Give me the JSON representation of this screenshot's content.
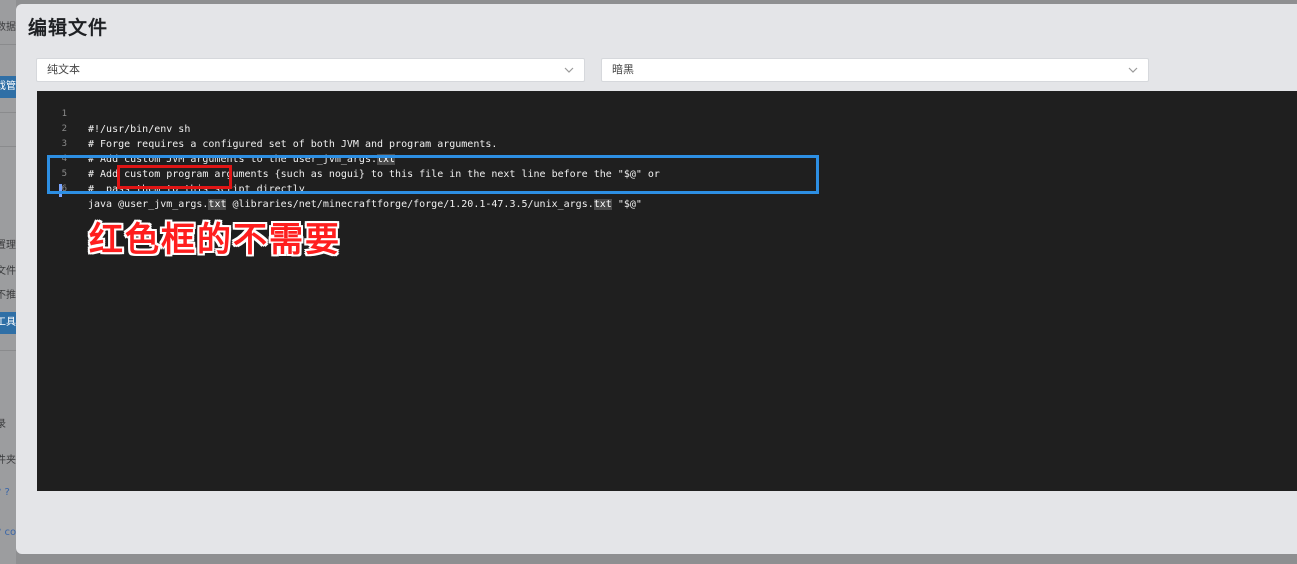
{
  "background": {
    "fragments": [
      "数据",
      "戏管",
      "置理",
      "文件",
      "不推",
      "工具",
      "录",
      "件夹",
      "? ?",
      "? co"
    ]
  },
  "dialog": {
    "title": "编辑文件",
    "language_select": {
      "value": "纯文本",
      "icon": "chevron-down-icon"
    },
    "theme_select": {
      "value": "暗黑",
      "icon": "chevron-down-icon"
    }
  },
  "editor": {
    "lines": [
      {
        "num": "1",
        "text": "#!/usr/bin/env sh"
      },
      {
        "num": "2",
        "text": "# Forge requires a configured set of both JVM and program arguments."
      },
      {
        "num": "3",
        "pre": "# Add custom JVM arguments to the user_jvm_args.",
        "hl": "txt"
      },
      {
        "num": "4",
        "text": "# Add custom program arguments {such as nogui} to this file in the next line before the \"$@\" or"
      },
      {
        "num": "5",
        "text": "#  pass them to this script directly"
      },
      {
        "num": "6",
        "p1": "java @user_jvm_args.",
        "h1": "txt",
        "p2": " @libraries/net/minecraftforge/forge/1.20.1-47.3.5/unix_args.",
        "h2": "txt",
        "p3": " \"$@\""
      }
    ]
  },
  "annotation": {
    "note": "红色框的不需要",
    "colors": {
      "blue_box": "#2d8fe3",
      "red_box": "#e01515",
      "note_text": "#ff1e1e"
    }
  }
}
